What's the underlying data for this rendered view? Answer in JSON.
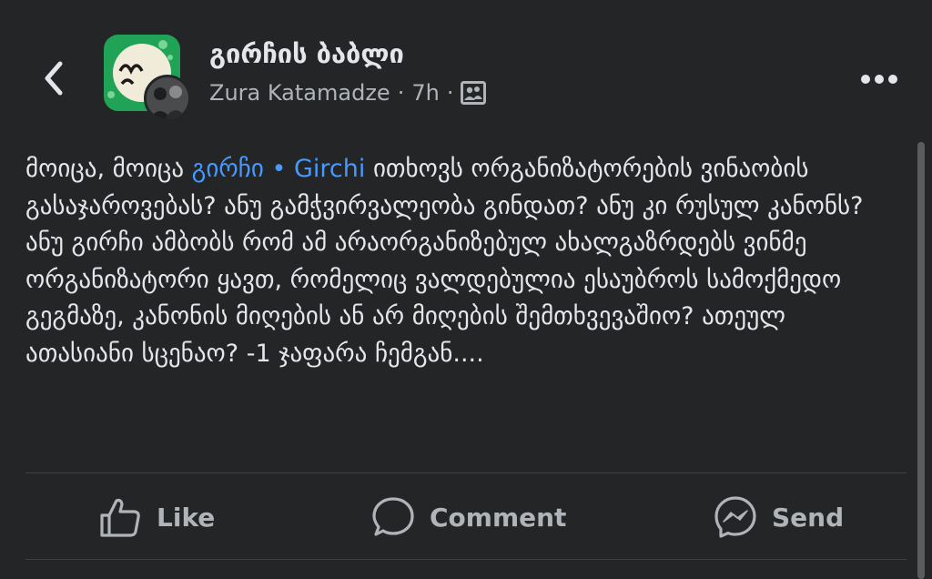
{
  "header": {
    "group_name": "გირჩის ბაბლი",
    "author": "Zura Katamadze",
    "separator": "·",
    "time": "7h"
  },
  "post": {
    "text_before_mention": "მოიცა, მოიცა ",
    "mention": "გირჩი • Girchi",
    "text_after_mention": "  ითხოვს ორგანიზატორების ვინაობის გასაჯაროვებას? ანუ გამჭვირვალეობა გინდათ? ანუ კი რუსულ კანონს? ანუ გირჩი ამბობს რომ ამ არაორგანიზებულ ახალგაზრდებს ვინმე ორგანიზატორი ყავთ, რომელიც ვალდებულია ესაუბროს სამოქმედო გეგმაზე, კანონის მიღების ან არ მიღების შემთხვევაშიო? ათეულ ათასიანი სცენაო?   -1 ჯაფარა ჩემგან...."
  },
  "actions": {
    "like": "Like",
    "comment": "Comment",
    "send": "Send"
  },
  "colors": {
    "background": "#242526",
    "text": "#e4e6eb",
    "secondary": "#b0b3b8",
    "mention": "#4599ff",
    "divider": "#3e4042"
  },
  "icons": {
    "back": "chevron-left-icon",
    "privacy": "members-group-icon",
    "more": "more-horizontal-icon",
    "like": "thumbs-up-icon",
    "comment": "comment-bubble-icon",
    "send": "messenger-icon"
  }
}
